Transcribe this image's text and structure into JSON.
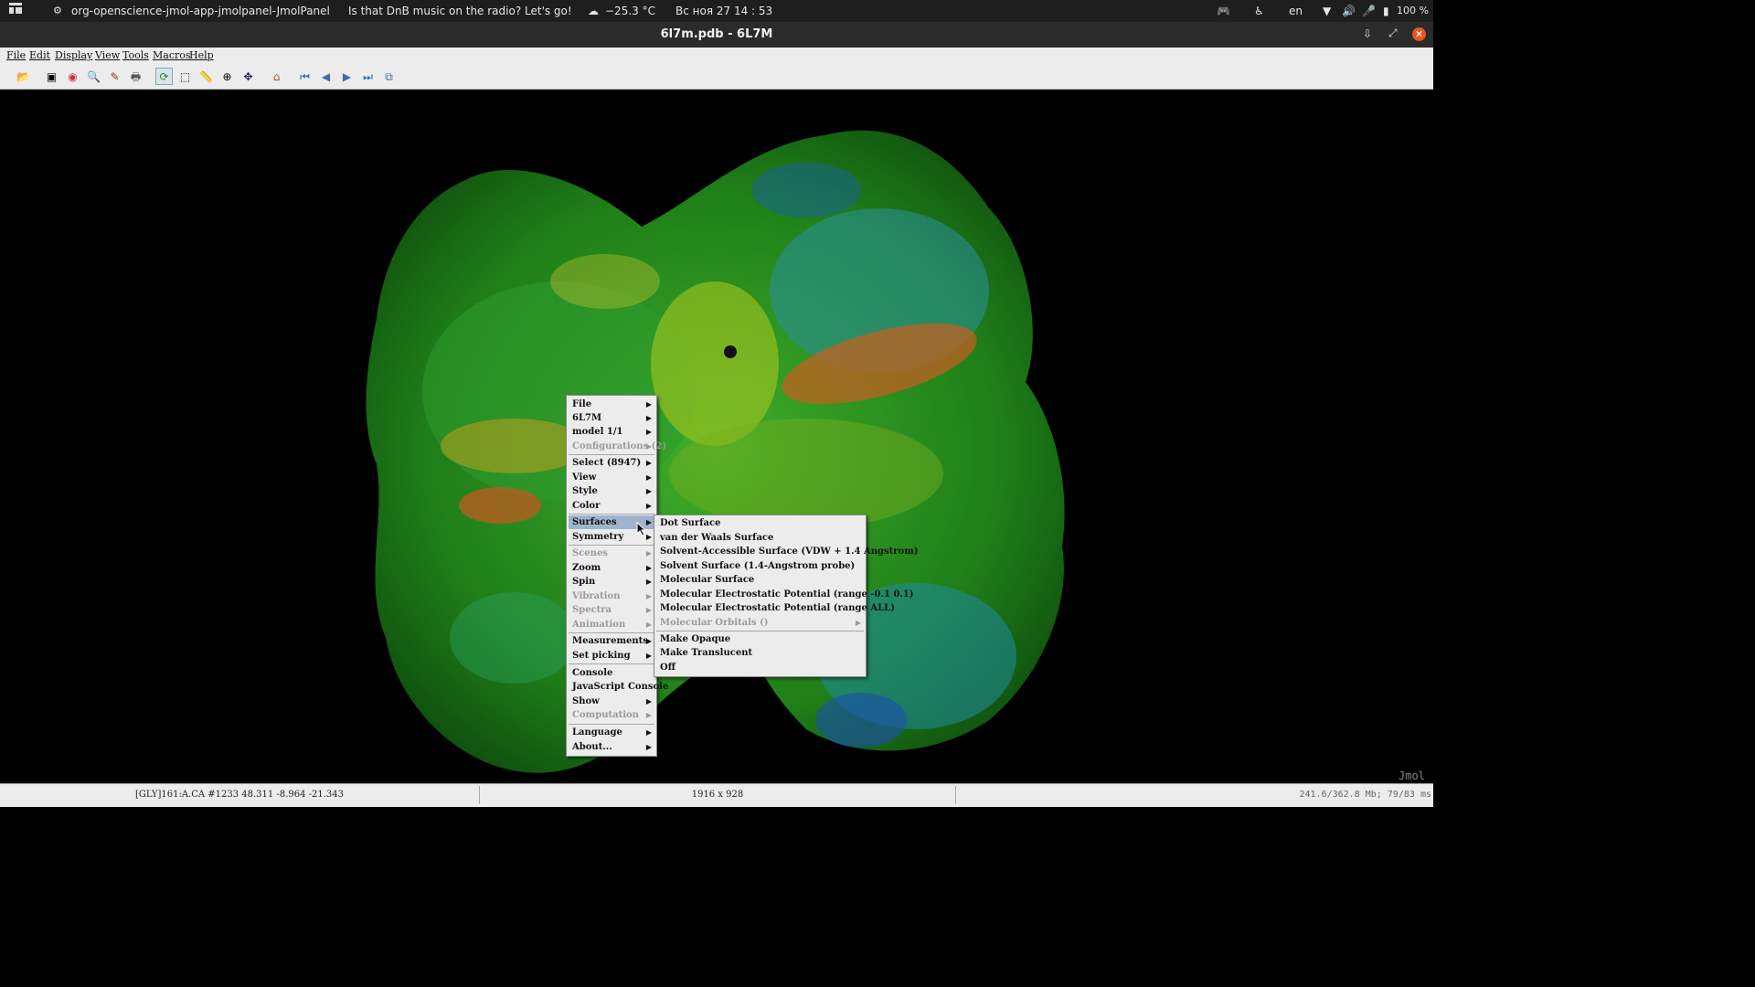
{
  "topbar": {
    "app_name": "org-openscience-jmol-app-jmolpanel-JmolPanel",
    "radio": "Is that DnB music on the radio? Let's go!",
    "temperature": "−25.3 °C",
    "datetime": "Вс ноя 27  14 : 53",
    "language": "en",
    "battery": "100 %"
  },
  "window": {
    "title": "6l7m.pdb - 6L7M"
  },
  "menubar": [
    "File",
    "Edit",
    "Display",
    "View",
    "Tools",
    "Macros",
    "Help"
  ],
  "viewer": {
    "watermark": "Jmol"
  },
  "status": {
    "atom": "[GLY]161:A.CA #1233 48.311 -8.964 -21.343",
    "size": "1916 x 928",
    "memory": "241.6/362.8 Mb;   79/83 ms"
  },
  "popup": {
    "items": [
      {
        "label": "File",
        "sub": true,
        "enabled": true
      },
      {
        "label": "6L7M",
        "sub": true,
        "enabled": true
      },
      {
        "label": "model 1/1",
        "sub": true,
        "enabled": true
      },
      {
        "label": "Configurations (2)",
        "sub": true,
        "enabled": false
      },
      {
        "label": "Select (8947)",
        "sub": true,
        "enabled": true
      },
      {
        "label": "View",
        "sub": true,
        "enabled": true
      },
      {
        "label": "Style",
        "sub": true,
        "enabled": true
      },
      {
        "label": "Color",
        "sub": true,
        "enabled": true
      },
      {
        "label": "Surfaces",
        "sub": true,
        "enabled": true
      },
      {
        "label": "Symmetry",
        "sub": true,
        "enabled": true
      },
      {
        "label": "Scenes",
        "sub": true,
        "enabled": false
      },
      {
        "label": "Zoom",
        "sub": true,
        "enabled": true
      },
      {
        "label": "Spin",
        "sub": true,
        "enabled": true
      },
      {
        "label": "Vibration",
        "sub": true,
        "enabled": false
      },
      {
        "label": "Spectra",
        "sub": true,
        "enabled": false
      },
      {
        "label": "Animation",
        "sub": true,
        "enabled": false
      },
      {
        "label": "Measurements",
        "sub": true,
        "enabled": true
      },
      {
        "label": "Set picking",
        "sub": true,
        "enabled": true
      },
      {
        "label": "Console",
        "sub": false,
        "enabled": true
      },
      {
        "label": "JavaScript Console",
        "sub": false,
        "enabled": true
      },
      {
        "label": "Show",
        "sub": true,
        "enabled": true
      },
      {
        "label": "Computation",
        "sub": true,
        "enabled": false
      },
      {
        "label": "Language",
        "sub": true,
        "enabled": true
      },
      {
        "label": "About...",
        "sub": true,
        "enabled": true
      }
    ]
  },
  "surfaces_menu": {
    "items": [
      {
        "label": "Dot Surface",
        "enabled": true
      },
      {
        "label": "van der Waals Surface",
        "enabled": true
      },
      {
        "label": "Solvent-Accessible Surface (VDW + 1.4 Angstrom)",
        "enabled": true
      },
      {
        "label": "Solvent Surface (1.4-Angstrom probe)",
        "enabled": true
      },
      {
        "label": "Molecular Surface",
        "enabled": true
      },
      {
        "label": "Molecular Electrostatic Potential (range -0.1 0.1)",
        "enabled": true
      },
      {
        "label": "Molecular Electrostatic Potential (range ALL)",
        "enabled": true
      },
      {
        "label": "Molecular Orbitals ()",
        "enabled": false
      },
      {
        "label": "Make Opaque",
        "enabled": true
      },
      {
        "label": "Make Translucent",
        "enabled": true
      },
      {
        "label": "Off",
        "enabled": true
      }
    ]
  },
  "colors": {
    "accent": "#9fb3cc",
    "close": "#e95420"
  }
}
